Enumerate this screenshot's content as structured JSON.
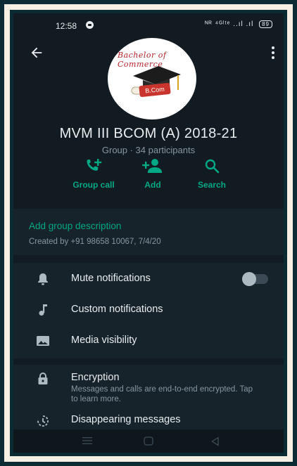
{
  "status_bar": {
    "time": "12:58",
    "signal_text": "ᴺᴿ ⁴ᴳˡᵗᵉ",
    "battery": "89"
  },
  "group": {
    "title": "MVM III BCOM (A) 2018-21",
    "subtitle": "Group · 34 participants",
    "avatar_banner_text": "Bachelor of Commerce",
    "avatar_badge_text": "B.Com"
  },
  "actions": [
    {
      "label": "Group call",
      "icon": "call-add-icon"
    },
    {
      "label": "Add",
      "icon": "person-add-icon"
    },
    {
      "label": "Search",
      "icon": "search-icon"
    }
  ],
  "description": {
    "link": "Add group description",
    "created": "Created by +91 98658 10067, 7/4/20"
  },
  "settings": {
    "mute": "Mute notifications",
    "mute_enabled": false,
    "custom": "Custom notifications",
    "media": "Media visibility"
  },
  "encryption": {
    "title": "Encryption",
    "subtitle": "Messages and calls are end-to-end encrypted. Tap to learn more."
  },
  "disappearing": {
    "title": "Disappearing messages"
  },
  "colors": {
    "accent": "#00a884",
    "background": "#121b22",
    "section": "#16232b"
  }
}
